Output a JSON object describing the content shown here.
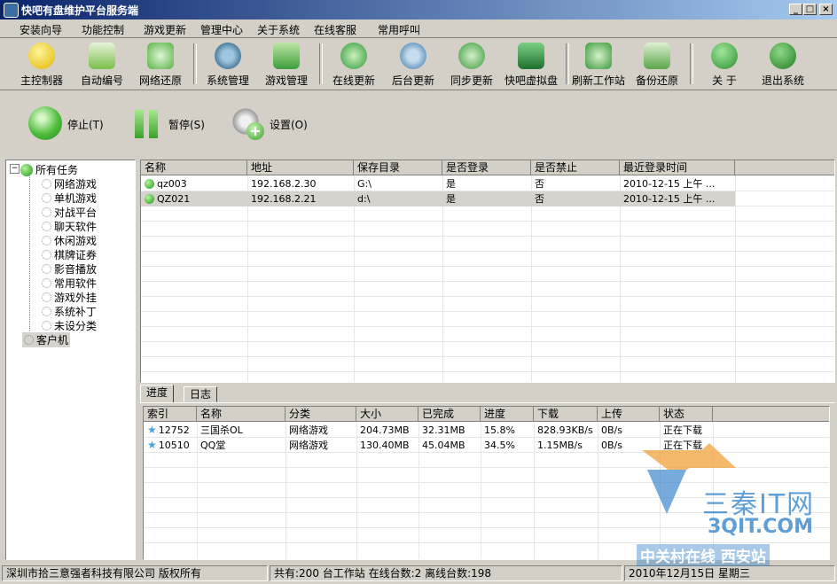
{
  "window": {
    "title": "快吧有盘维护平台服务端",
    "min": "_",
    "max": "□",
    "close": "×"
  },
  "menu": [
    "安装向导",
    "功能控制",
    "游戏更新",
    "管理中心",
    "关于系统",
    "在线客服",
    "常用呼叫"
  ],
  "toolbar": [
    {
      "label": "主控制器",
      "icon": "smiley-icon",
      "color": "#f5d000"
    },
    {
      "label": "自动编号",
      "icon": "document-icon",
      "color": "#7bbf4a"
    },
    {
      "label": "网络还原",
      "icon": "network-restore-icon",
      "color": "#58b244"
    },
    {
      "label": "系统管理",
      "icon": "gear-icon",
      "color": "#6aa3c9"
    },
    {
      "label": "游戏管理",
      "icon": "game-icon",
      "color": "#3c9e3c"
    },
    {
      "label": "在线更新",
      "icon": "online-update-icon",
      "color": "#2f9a38"
    },
    {
      "label": "后台更新",
      "icon": "background-update-icon",
      "color": "#6f9fc4"
    },
    {
      "label": "同步更新",
      "icon": "sync-icon",
      "color": "#3b9a3b"
    },
    {
      "label": "快吧虚拟盘",
      "icon": "virtual-disk-icon",
      "color": "#2b8a3e"
    },
    {
      "label": "刷新工作站",
      "icon": "refresh-workstation-icon",
      "color": "#3a9a3a"
    },
    {
      "label": "备份还原",
      "icon": "backup-icon",
      "color": "#5aa64a"
    },
    {
      "label": "关  于",
      "icon": "info-icon",
      "color": "#2e8f2e"
    },
    {
      "label": "退出系统",
      "icon": "power-icon",
      "color": "#1f7d1f"
    }
  ],
  "actions": {
    "stop": {
      "label": "停止(T)",
      "icon": "stop-icon"
    },
    "pause": {
      "label": "暂停(S)",
      "icon": "pause-icon"
    },
    "settings": {
      "label": "设置(O)",
      "icon": "settings-add-icon"
    }
  },
  "tree": {
    "root": "所有任务",
    "children": [
      "网络游戏",
      "单机游戏",
      "对战平台",
      "聊天软件",
      "休闲游戏",
      "棋牌证券",
      "影音播放",
      "常用软件",
      "游戏外挂",
      "系统补丁",
      "未设分类"
    ],
    "client": "客户机"
  },
  "clients": {
    "columns": [
      "名称",
      "地址",
      "保存目录",
      "是否登录",
      "是否禁止",
      "最近登录时间"
    ],
    "rows": [
      [
        "qz003",
        "192.168.2.30",
        "G:\\",
        "是",
        "否",
        "2010-12-15 上午 ..."
      ],
      [
        "QZ021",
        "192.168.2.21",
        "d:\\",
        "是",
        "否",
        "2010-12-15 上午 ..."
      ]
    ]
  },
  "tabs": [
    "进度",
    "日志"
  ],
  "downloads": {
    "columns": [
      "索引",
      "名称",
      "分类",
      "大小",
      "已完成",
      "进度",
      "下载",
      "上传",
      "状态"
    ],
    "rows": [
      [
        "12752",
        "三国杀OL",
        "网络游戏",
        "204.73MB",
        "32.31MB",
        "15.8%",
        "828.93KB/s",
        "0B/s",
        "正在下载"
      ],
      [
        "10510",
        "QQ堂",
        "网络游戏",
        "130.40MB",
        "45.04MB",
        "34.5%",
        "1.15MB/s",
        "0B/s",
        "正在下载"
      ]
    ]
  },
  "status": {
    "copyright": "深圳市拾三意强者科技有限公司 版权所有",
    "stats": "共有:200 台工作站  在线台数:2  离线台数:198",
    "date": "2010年12月15日 星期三"
  },
  "watermark": {
    "brand": "三秦IT网",
    "domain": "3QIT.COM",
    "tagline": "中关村在线 西安站"
  }
}
